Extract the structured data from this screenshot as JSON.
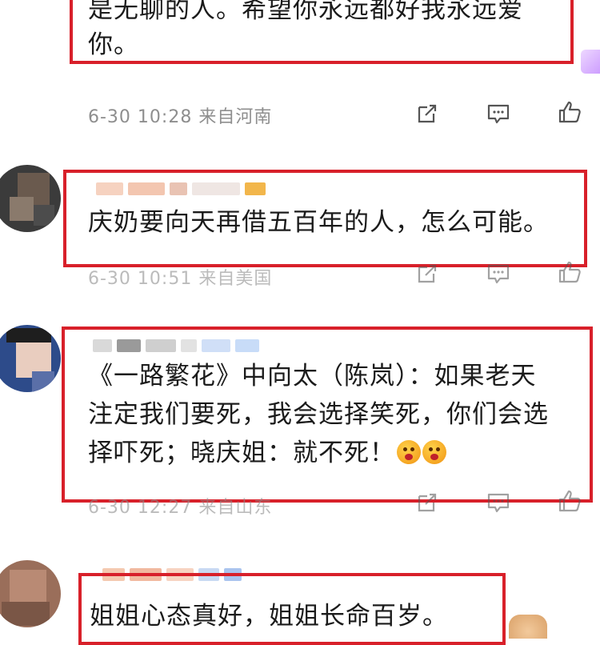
{
  "comments": [
    {
      "text_lines": [
        "是无聊的人。希望你永远都好我永远爱",
        "你。"
      ],
      "meta": "6-30 10:28  来自河南"
    },
    {
      "text_lines": [
        "庆奶要向天再借五百年的人，怎么可能。"
      ],
      "meta": "6-30 10:51  来自美国"
    },
    {
      "text_lines": [
        "《一路繁花》中向太（陈岚）：如果老天",
        "注定我们要死，我会选择笑死，你们会选",
        "择吓死；晓庆姐：就不死！"
      ],
      "meta": "6-30 12:27  来自山东"
    },
    {
      "text_lines": [
        "姐姐心态真好，姐姐长命百岁。"
      ],
      "meta": ""
    }
  ],
  "icons": {
    "share": "share-icon",
    "comment": "comment-icon",
    "like": "thumbs-up-icon"
  },
  "colors": {
    "highlight": "#d8202a",
    "meta_text": "#8e8e8e"
  }
}
